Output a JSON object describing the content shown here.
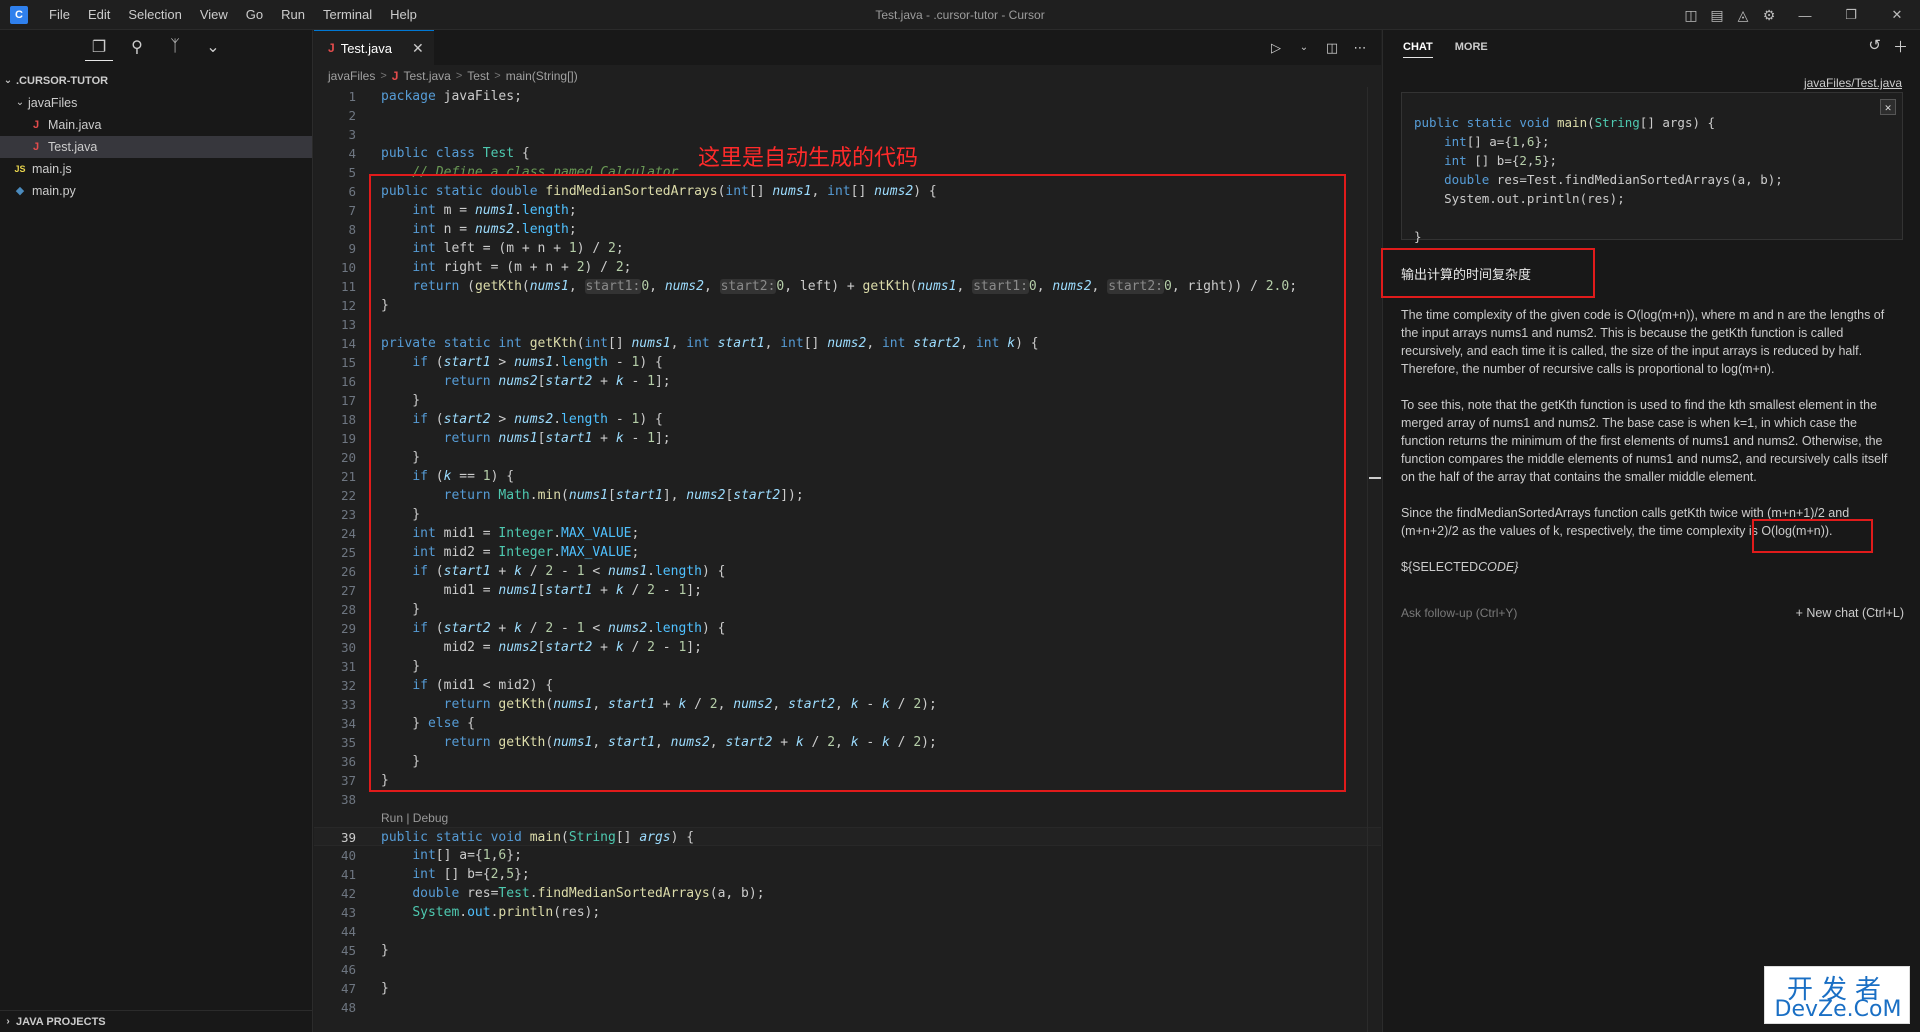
{
  "titlebar": {
    "menu": [
      "File",
      "Edit",
      "Selection",
      "View",
      "Go",
      "Run",
      "Terminal",
      "Help"
    ],
    "window_title": "Test.java - .cursor-tutor - Cursor"
  },
  "sidebar": {
    "root_label": ".CURSOR-TUTOR",
    "folder_label": "javaFiles",
    "files": [
      {
        "name": "Main.java",
        "icon": "java-icon"
      },
      {
        "name": "Test.java",
        "icon": "java-icon",
        "selected": true
      },
      {
        "name": "main.js",
        "icon": "js-icon"
      },
      {
        "name": "main.py",
        "icon": "python-icon"
      }
    ],
    "bottom_section": "JAVA PROJECTS"
  },
  "editor": {
    "tab_label": "Test.java",
    "breadcrumb": [
      "javaFiles",
      "Test.java",
      "Test",
      "main(String[])"
    ],
    "codelens": "Run | Debug",
    "current_line": 39
  },
  "annotation": {
    "text": "这里是自动生成的代码"
  },
  "chat": {
    "tabs": [
      "CHAT",
      "MORE"
    ],
    "file_link": "javaFiles/Test.java",
    "user_question": "输出计算的时间复杂度",
    "answer": [
      "The time complexity of the given code is O(log(m+n)), where m and n are the lengths of the input arrays nums1 and nums2. This is because the getKth function is called recursively, and each time it is called, the size of the input arrays is reduced by half. Therefore, the number of recursive calls is proportional to log(m+n).",
      "To see this, note that the getKth function is used to find the kth smallest element in the merged array of nums1 and nums2. The base case is when k=1, in which case the function returns the minimum of the first elements of nums1 and nums2. Otherwise, the function compares the middle elements of nums1 and nums2, and recursively calls itself on the half of the array that contains the smaller middle element.",
      "Since the findMedianSortedArrays function calls getKth twice with (m+n+1)/2 and (m+n+2)/2 as the values of k, respectively, the time complexity is O(log(m+n))."
    ],
    "selected_code_token_prefix": "${SELECTED",
    "selected_code_token_suffix": "CODE}",
    "ask_placeholder": "Ask follow-up (Ctrl+Y)",
    "new_chat_label": "New chat (Ctrl+L)"
  },
  "watermark": {
    "line1": "开发者",
    "line2": "DevZe.CoM"
  },
  "colors": {
    "accent": "#0078d4",
    "annotation_red": "#e01b1b",
    "keyword": "#569cd6",
    "function": "#dcdcaa"
  }
}
